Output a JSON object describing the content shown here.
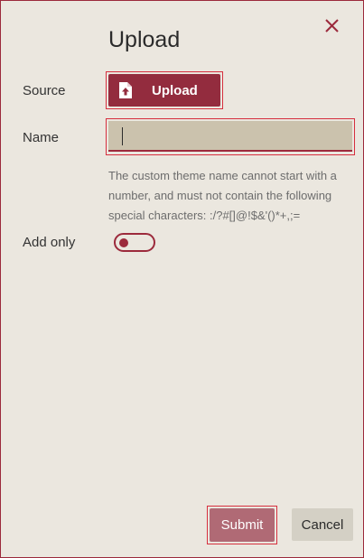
{
  "dialog": {
    "title": "Upload",
    "close_icon": "close-icon"
  },
  "form": {
    "source_label": "Source",
    "upload_button_label": "Upload",
    "upload_icon": "file-upload-icon",
    "name_label": "Name",
    "name_value": "",
    "hint": "The custom theme name cannot start with a number, and must not contain the following special characters: :/?#[]@!$&'()*+,;=",
    "add_only_label": "Add only",
    "add_only_on": false
  },
  "footer": {
    "submit_label": "Submit",
    "cancel_label": "Cancel"
  },
  "colors": {
    "accent": "#932c3e",
    "background": "#ebe7df",
    "input_fill": "#cbc2ad",
    "focus": "#d62f3e",
    "submit_disabled": "#b06a75",
    "cancel": "#d4d0c5"
  }
}
